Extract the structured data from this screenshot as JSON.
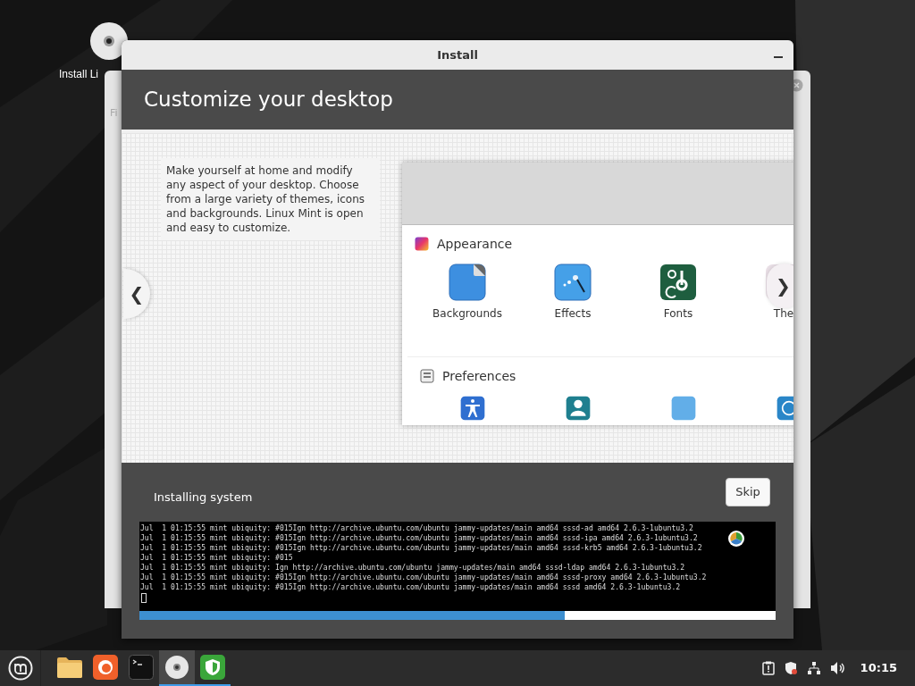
{
  "desktop_icon": {
    "label": "Install Li"
  },
  "back_window": {
    "text": "Fi"
  },
  "window": {
    "title": "Install",
    "header": "Customize your desktop",
    "slide": {
      "description": "Make yourself at home and modify any aspect of your desktop. Choose from a large variety of themes, icons and backgrounds. Linux Mint is open and easy to customize.",
      "prev_arrow": "❮",
      "next_arrow": "❯",
      "sections": [
        {
          "title": "Appearance",
          "kind": "appearance",
          "items": [
            {
              "label": "Backgrounds",
              "kind": "backgrounds"
            },
            {
              "label": "Effects",
              "kind": "effects"
            },
            {
              "label": "Fonts",
              "kind": "fonts"
            },
            {
              "label": "The",
              "kind": "themes"
            }
          ]
        },
        {
          "title": "Preferences",
          "kind": "preferences",
          "items": [
            {
              "kind": "accessibility"
            },
            {
              "kind": "account"
            },
            {
              "kind": "blank"
            },
            {
              "kind": "clock"
            }
          ]
        }
      ]
    },
    "status": "Installing system",
    "skip_button": "Skip",
    "log": [
      "Jul  1 01:15:55 mint ubiquity: #015Ign http://archive.ubuntu.com/ubuntu jammy-updates/main amd64 sssd-ad amd64 2.6.3-1ubuntu3.2",
      "Jul  1 01:15:55 mint ubiquity: #015Ign http://archive.ubuntu.com/ubuntu jammy-updates/main amd64 sssd-ipa amd64 2.6.3-1ubuntu3.2",
      "Jul  1 01:15:55 mint ubiquity: #015Ign http://archive.ubuntu.com/ubuntu jammy-updates/main amd64 sssd-krb5 amd64 2.6.3-1ubuntu3.2",
      "Jul  1 01:15:55 mint ubiquity: #015",
      "Jul  1 01:15:55 mint ubiquity: Ign http://archive.ubuntu.com/ubuntu jammy-updates/main amd64 sssd-ldap amd64 2.6.3-1ubuntu3.2",
      "Jul  1 01:15:55 mint ubiquity: #015Ign http://archive.ubuntu.com/ubuntu jammy-updates/main amd64 sssd-proxy amd64 2.6.3-1ubuntu3.2",
      "Jul  1 01:15:55 mint ubiquity: #015Ign http://archive.ubuntu.com/ubuntu jammy-updates/main amd64 sssd amd64 2.6.3-1ubuntu3.2"
    ],
    "progress": {
      "level": 0.668
    }
  },
  "taskbar": {
    "launchers": [
      {
        "kind": "folder",
        "running": false,
        "selected": false
      },
      {
        "kind": "firefox",
        "running": false,
        "selected": false
      },
      {
        "kind": "terminal",
        "running": false,
        "selected": false
      },
      {
        "kind": "disc",
        "running": true,
        "selected": true
      },
      {
        "kind": "shield",
        "running": true,
        "selected": false
      }
    ],
    "tray": [
      {
        "kind": "clipboard"
      },
      {
        "kind": "shield"
      },
      {
        "kind": "network"
      },
      {
        "kind": "volume"
      }
    ],
    "clock": "10:15"
  }
}
